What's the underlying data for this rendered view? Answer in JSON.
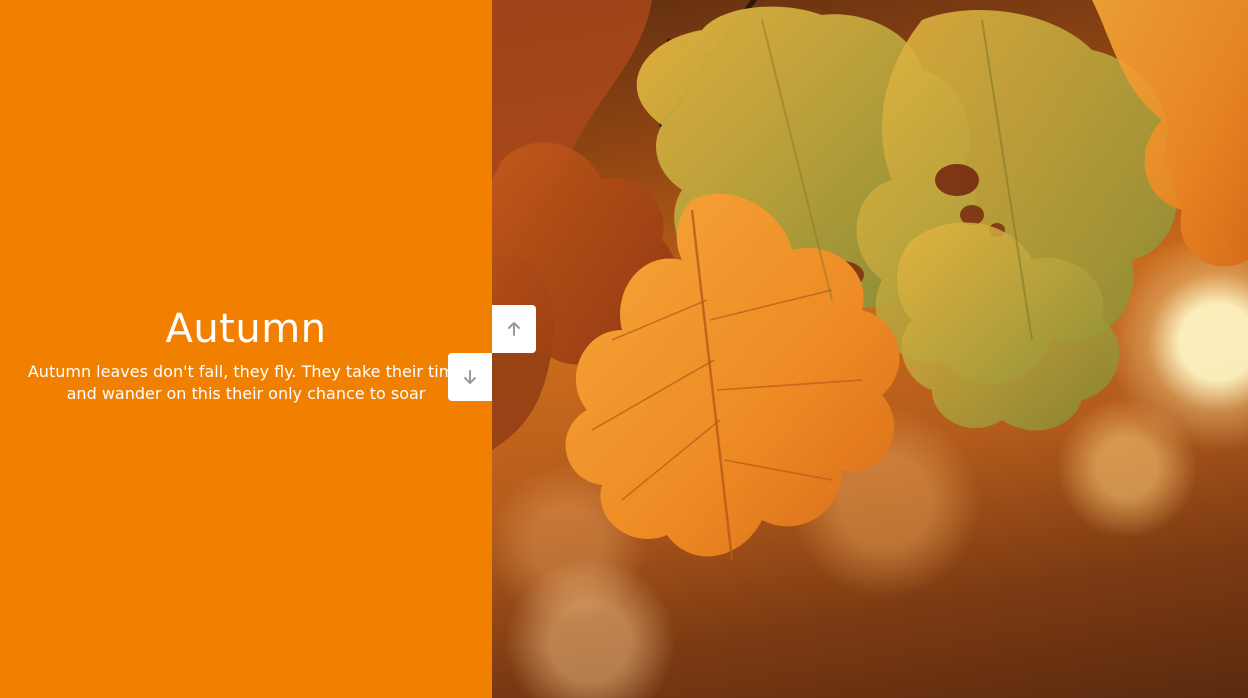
{
  "slide": {
    "title": "Autumn",
    "description": "Autumn leaves don't fall, they fly. They take their time and wander on this their only chance to soar",
    "background_color": "#f18000",
    "image_alt": "Backlit orange and green oak leaves with bokeh background"
  },
  "navigation": {
    "up_icon": "arrow-up-icon",
    "down_icon": "arrow-down-icon",
    "button_background": "#ffffff",
    "icon_color": "#9a9a9a"
  }
}
